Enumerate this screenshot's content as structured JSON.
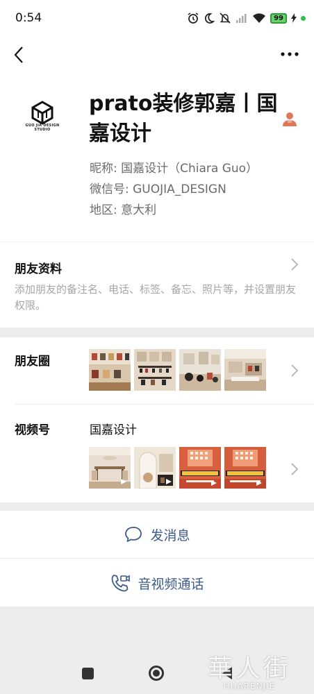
{
  "status_bar": {
    "time": "0:54",
    "battery": "99",
    "icons": [
      "alarm-icon",
      "moon-icon",
      "mute-icon",
      "signal-icon",
      "wifi-icon",
      "battery-icon",
      "charging-icon",
      "dot-icon"
    ]
  },
  "nav": {
    "back_icon": "chevron-left-icon",
    "more_icon": "ellipsis-icon"
  },
  "profile": {
    "logo_caption": "GUO JIA DESIGN STUDIO",
    "name": "prato装修郭嘉丨国嘉设计",
    "nickname": "昵称:  国嘉设计（Chiara Guo）",
    "wechat_id": "微信号:  GUOJIA_DESIGN",
    "region": "地区:  意大利"
  },
  "friend_info": {
    "title": "朋友资料",
    "description": "添加朋友的备注名、电话、标签、备忘、照片等，并设置朋友权限。"
  },
  "moments": {
    "title": "朋友圈"
  },
  "channels": {
    "title": "视频号",
    "name": "国嘉设计"
  },
  "actions": {
    "message": "发消息",
    "call": "音视频通话"
  },
  "watermark": {
    "big": "華人街",
    "small": "HUARENJIE"
  },
  "colors": {
    "link_blue": "#3c5a8a",
    "bg": "#ededed",
    "battery_green": "#6cd26a"
  }
}
